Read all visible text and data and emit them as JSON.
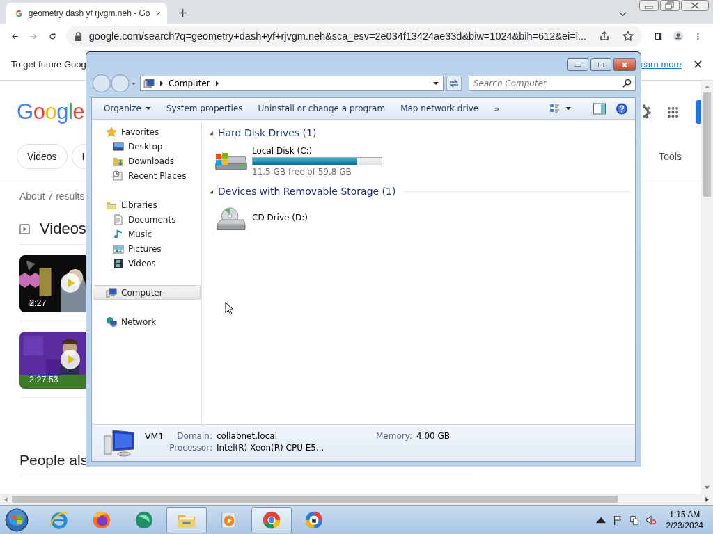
{
  "browser": {
    "tab_title": "geometry dash yf rjvgm.neh - Go",
    "url": "google.com/search?q=geometry+dash+yf+rjvgm.neh&sca_esv=2e034f13424ae33d&biw=1024&bih=612&ei=i...",
    "infobar": {
      "text": "To get future Goog",
      "link": "earn more"
    }
  },
  "google": {
    "logo": "Google",
    "chips": [
      "Videos",
      "I"
    ],
    "tools": "Tools",
    "result_stats": "About 7 results",
    "videos_heading": "Videos",
    "videos": [
      {
        "duration": "2:27"
      },
      {
        "duration": "2:27:53"
      }
    ],
    "people_also_ask": "People als"
  },
  "explorer": {
    "address": "Computer",
    "search_placeholder": "Search Computer",
    "toolbar": [
      {
        "label": "Organize",
        "dropdown": true
      },
      {
        "label": "System properties",
        "dropdown": false
      },
      {
        "label": "Uninstall or change a program",
        "dropdown": false
      },
      {
        "label": "Map network drive",
        "dropdown": false
      }
    ],
    "more": "»",
    "nav": [
      {
        "label": "Favorites",
        "kind": "favorites",
        "selected": false,
        "children": [
          {
            "label": "Desktop",
            "kind": "desktop",
            "selected": false
          },
          {
            "label": "Downloads",
            "kind": "downloads",
            "selected": false
          },
          {
            "label": "Recent Places",
            "kind": "recent",
            "selected": false
          }
        ]
      },
      {
        "label": "Libraries",
        "kind": "libraries",
        "selected": false,
        "children": [
          {
            "label": "Documents",
            "kind": "documents",
            "selected": false
          },
          {
            "label": "Music",
            "kind": "music",
            "selected": false
          },
          {
            "label": "Pictures",
            "kind": "pictures",
            "selected": false
          },
          {
            "label": "Videos",
            "kind": "videos",
            "selected": false
          }
        ]
      },
      {
        "label": "Computer",
        "kind": "computer",
        "selected": true
      },
      {
        "label": "Network",
        "kind": "network",
        "selected": false
      }
    ],
    "groups": [
      {
        "title": "Hard Disk Drives (1)",
        "expanded": true,
        "drives": [
          {
            "name": "Local Disk (C:)",
            "kind": "hdd",
            "level": 0.81,
            "info": "11.5 GB free of 59.8 GB"
          }
        ]
      },
      {
        "title": "Devices with Removable Storage (1)",
        "expanded": true,
        "drives": [
          {
            "name": "CD Drive (D:)",
            "kind": "cd"
          }
        ]
      }
    ],
    "details": {
      "name": "VM1",
      "fields": [
        {
          "label": "Domain:",
          "value": "collabnet.local"
        },
        {
          "label": "Memory:",
          "value": "4.00 GB"
        },
        {
          "label": "Processor:",
          "value": "Intel(R) Xeon(R) CPU E5..."
        }
      ]
    }
  },
  "taskbar": {
    "apps": [
      {
        "kind": "ie",
        "active": false
      },
      {
        "kind": "firefox",
        "active": false
      },
      {
        "kind": "teal",
        "active": false
      },
      {
        "kind": "folder",
        "active": true
      },
      {
        "kind": "media",
        "active": false
      },
      {
        "kind": "chrome",
        "active": true
      },
      {
        "kind": "shield",
        "active": false
      }
    ],
    "time": "1:15 AM",
    "date": "2/23/2024"
  }
}
